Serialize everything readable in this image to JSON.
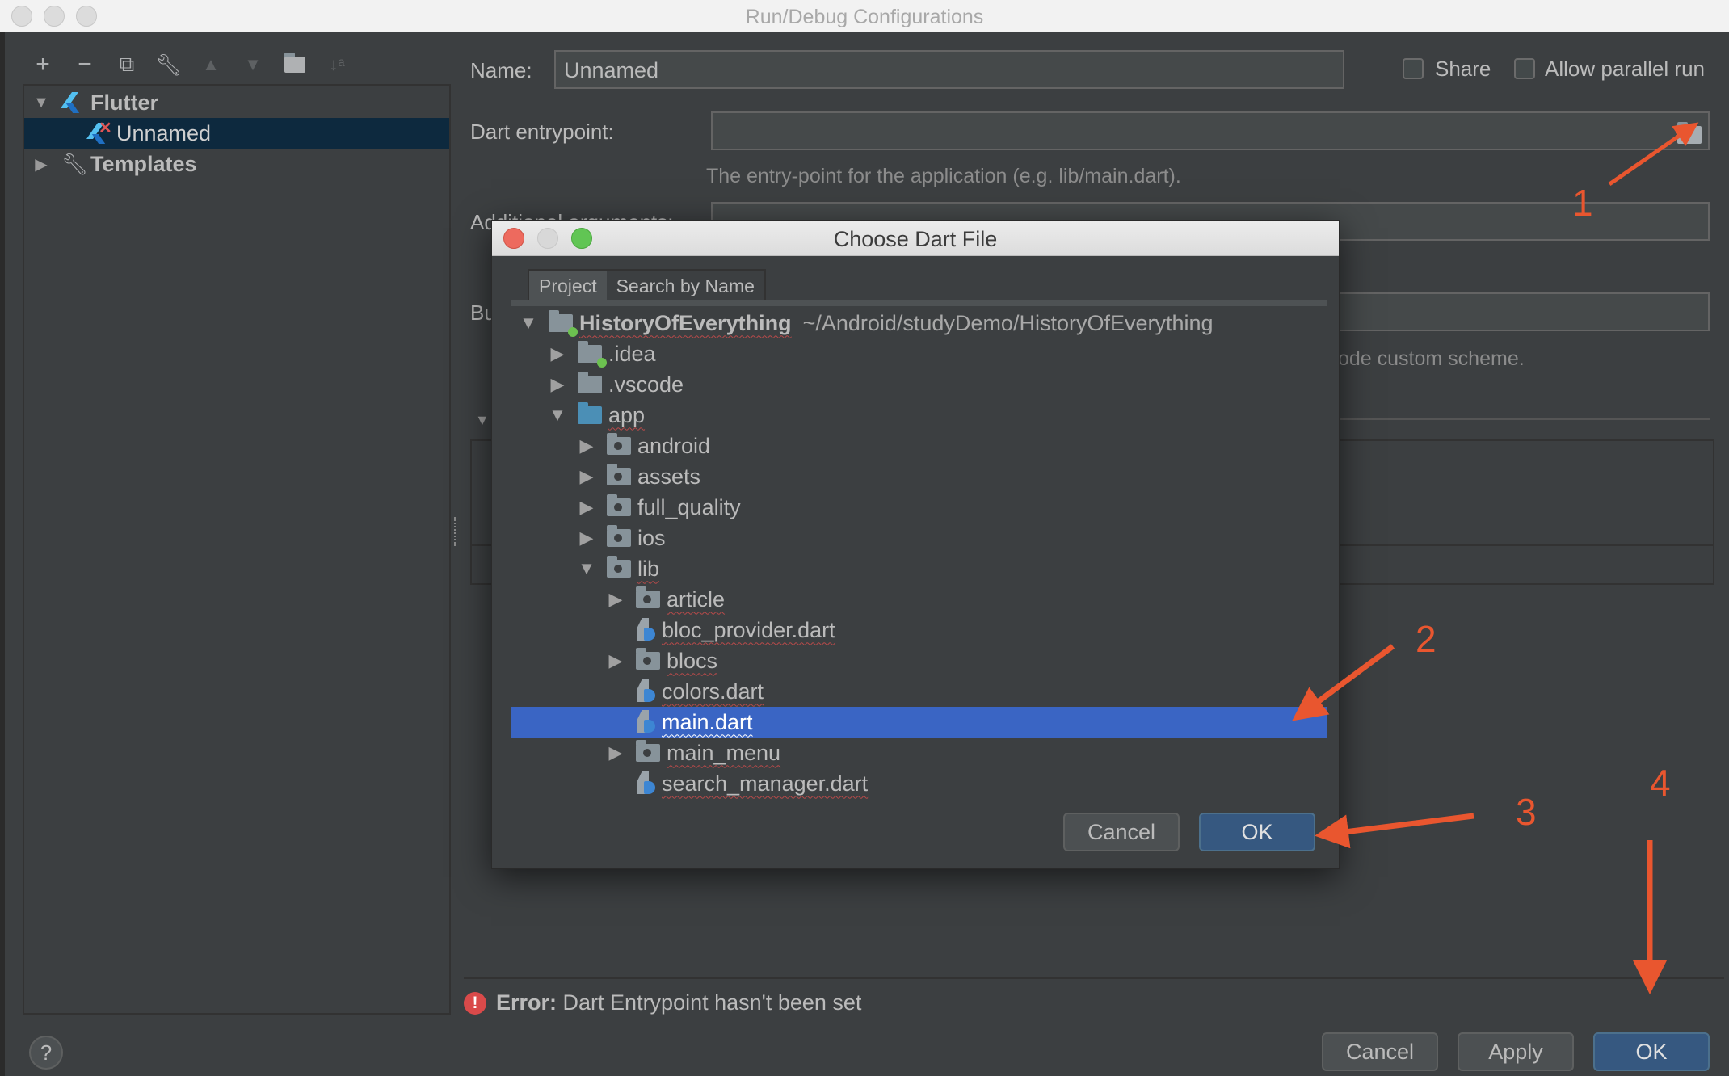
{
  "window": {
    "title": "Run/Debug Configurations"
  },
  "toolbar": {
    "icons": [
      "add-icon",
      "remove-icon",
      "copy-icon",
      "wrench-icon",
      "move-up-icon",
      "move-down-icon",
      "new-folder-icon",
      "sort-alpha-icon"
    ],
    "glyphs": [
      "+",
      "−",
      "⧉",
      "🔧",
      "▲",
      "▼",
      "📁",
      "↓ᵃ"
    ]
  },
  "config_tree": {
    "items": [
      {
        "label": "Flutter",
        "expanded": true,
        "bold": true
      },
      {
        "label": "Unnamed",
        "selected": true,
        "error": true
      },
      {
        "label": "Templates",
        "expanded": false,
        "bold": true
      }
    ]
  },
  "form": {
    "name_label": "Name:",
    "name_value": "Unnamed",
    "share_label": "Share",
    "share_checked": false,
    "allow_parallel_label": "Allow parallel run",
    "allow_parallel_checked": false,
    "entrypoint_label": "Dart entrypoint:",
    "entrypoint_value": "",
    "entrypoint_hint": "The entry-point for the application (e.g. lib/main.dart).",
    "additional_args_label": "Additional arguments:",
    "build_label": "Bu",
    "scheme_hint_fragment": "ode custom scheme."
  },
  "error": {
    "prefix": "Error:",
    "message": "Dart Entrypoint hasn't been set"
  },
  "buttons": {
    "cancel": "Cancel",
    "apply": "Apply",
    "ok": "OK",
    "help": "?"
  },
  "dialog": {
    "title": "Choose Dart File",
    "tabs": [
      {
        "label": "Project",
        "active": true
      },
      {
        "label": "Search by Name",
        "active": false
      }
    ],
    "tree": [
      {
        "name": "HistoryOfEverything",
        "path": "~/Android/studyDemo/HistoryOfEverything",
        "type": "project",
        "depth": 0,
        "expanded": true
      },
      {
        "name": ".idea",
        "type": "folder-module",
        "depth": 1,
        "expanded": false
      },
      {
        "name": ".vscode",
        "type": "folder",
        "depth": 1,
        "expanded": false
      },
      {
        "name": "app",
        "type": "folder-blue",
        "depth": 1,
        "expanded": true
      },
      {
        "name": "android",
        "type": "package",
        "depth": 2,
        "expanded": false
      },
      {
        "name": "assets",
        "type": "package",
        "depth": 2,
        "expanded": false
      },
      {
        "name": "full_quality",
        "type": "package",
        "depth": 2,
        "expanded": false
      },
      {
        "name": "ios",
        "type": "package",
        "depth": 2,
        "expanded": false
      },
      {
        "name": "lib",
        "type": "package",
        "depth": 2,
        "expanded": true
      },
      {
        "name": "article",
        "type": "package",
        "depth": 3,
        "expanded": false
      },
      {
        "name": "bloc_provider.dart",
        "type": "dart",
        "depth": 3
      },
      {
        "name": "blocs",
        "type": "package",
        "depth": 3,
        "expanded": false
      },
      {
        "name": "colors.dart",
        "type": "dart",
        "depth": 3
      },
      {
        "name": "main.dart",
        "type": "dart",
        "depth": 3,
        "selected": true
      },
      {
        "name": "main_menu",
        "type": "package",
        "depth": 3,
        "expanded": false
      },
      {
        "name": "search_manager.dart",
        "type": "dart",
        "depth": 3
      }
    ],
    "cancel": "Cancel",
    "ok": "OK"
  },
  "annotations": [
    "1",
    "2",
    "3",
    "4"
  ],
  "colors": {
    "accent_arrow": "#e9562f",
    "selection": "#3a65c4",
    "primary_button": "#365880",
    "tree_selection": "#0d293e"
  }
}
